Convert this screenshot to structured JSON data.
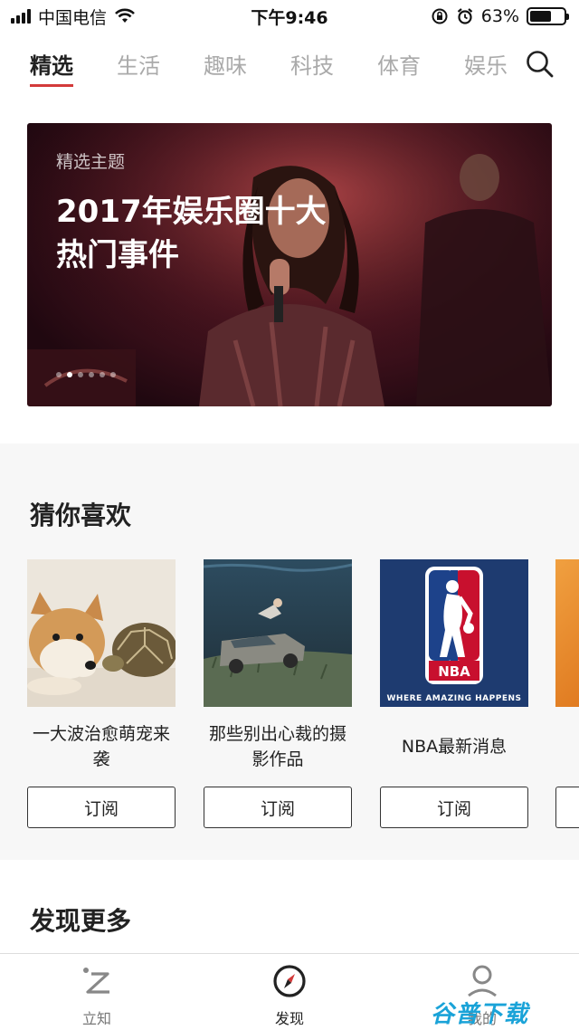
{
  "status_bar": {
    "carrier": "中国电信",
    "time": "下午9:46",
    "battery": "63%",
    "battery_level": 0.63
  },
  "tabs": [
    {
      "label": "精选",
      "active": true
    },
    {
      "label": "生活"
    },
    {
      "label": "趣味"
    },
    {
      "label": "科技"
    },
    {
      "label": "体育"
    },
    {
      "label": "娱乐"
    }
  ],
  "banner": {
    "subtitle": "精选主题",
    "title": "2017年娱乐圈十大热门事件",
    "slide_count": 6,
    "active_slide": 2
  },
  "recommend": {
    "title": "猜你喜欢",
    "cards": [
      {
        "title": "一大波治愈萌宠来袭",
        "button": "订阅",
        "image": "shiba-dog-and-tortoise"
      },
      {
        "title": "那些别出心裁的摄影作品",
        "button": "订阅",
        "image": "underwater-car-photo"
      },
      {
        "title": "NBA最新消息",
        "button": "订阅",
        "image": "nba-logo",
        "logo_text": "NBA",
        "logo_tagline": "WHERE AMAZING HAPPENS"
      }
    ]
  },
  "discover_more": {
    "title": "发现更多"
  },
  "bottom_nav": [
    {
      "label": "立知",
      "icon": "lizhi-icon"
    },
    {
      "label": "发现",
      "icon": "compass-icon",
      "active": true
    },
    {
      "label": "我的",
      "icon": "profile-icon"
    }
  ],
  "watermark": "谷普下载",
  "colors": {
    "accent": "#d33a3a",
    "nba_blue": "#1d428a",
    "nba_red": "#c8102e"
  }
}
